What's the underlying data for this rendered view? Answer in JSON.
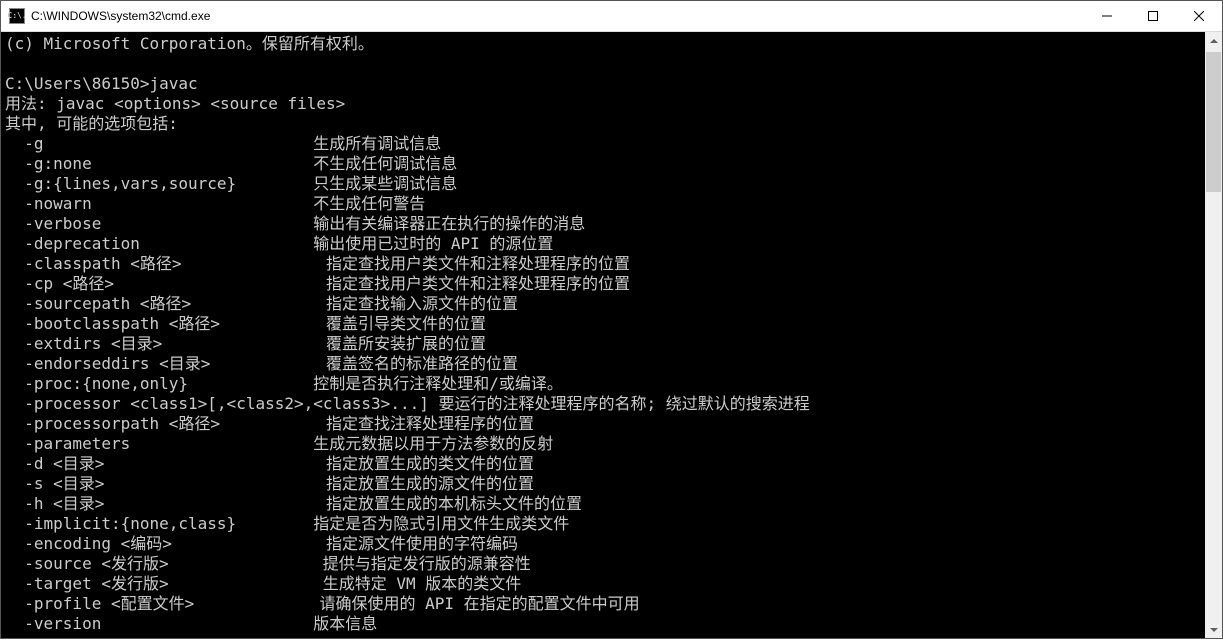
{
  "titlebar": {
    "title": "C:\\WINDOWS\\system32\\cmd.exe",
    "icon_text": "C:\\."
  },
  "terminal": {
    "line_copyright": "(c) Microsoft Corporation。保留所有权利。",
    "prompt": "C:\\Users\\86150>",
    "command": "javac",
    "usage": "用法: javac <options> <source files>",
    "options_header": "其中, 可能的选项包括:",
    "options": [
      {
        "flag": "-g",
        "desc": "生成所有调试信息"
      },
      {
        "flag": "-g:none",
        "desc": "不生成任何调试信息"
      },
      {
        "flag": "-g:{lines,vars,source}",
        "desc": "只生成某些调试信息"
      },
      {
        "flag": "-nowarn",
        "desc": "不生成任何警告"
      },
      {
        "flag": "-verbose",
        "desc": "输出有关编译器正在执行的操作的消息"
      },
      {
        "flag": "-deprecation",
        "desc": "输出使用已过时的 API 的源位置"
      },
      {
        "flag": "-classpath <路径>",
        "desc": "指定查找用户类文件和注释处理程序的位置",
        "indent": true
      },
      {
        "flag": "-cp <路径>",
        "desc": "指定查找用户类文件和注释处理程序的位置",
        "indent": true
      },
      {
        "flag": "-sourcepath <路径>",
        "desc": "指定查找输入源文件的位置",
        "indent": true
      },
      {
        "flag": "-bootclasspath <路径>",
        "desc": "覆盖引导类文件的位置",
        "indent": true
      },
      {
        "flag": "-extdirs <目录>",
        "desc": "覆盖所安装扩展的位置",
        "indent": true
      },
      {
        "flag": "-endorseddirs <目录>",
        "desc": "覆盖签名的标准路径的位置",
        "indent": true
      },
      {
        "flag": "-proc:{none,only}",
        "desc": "控制是否执行注释处理和/或编译。"
      },
      {
        "flag": "-processor <class1>[,<class2>,<class3>...]",
        "desc": "要运行的注释处理程序的名称; 绕过默认的搜索进程",
        "inline": true
      },
      {
        "flag": "-processorpath <路径>",
        "desc": "指定查找注释处理程序的位置",
        "indent": true
      },
      {
        "flag": "-parameters",
        "desc": "生成元数据以用于方法参数的反射"
      },
      {
        "flag": "-d <目录>",
        "desc": "指定放置生成的类文件的位置",
        "indent": true
      },
      {
        "flag": "-s <目录>",
        "desc": "指定放置生成的源文件的位置",
        "indent": true
      },
      {
        "flag": "-h <目录>",
        "desc": "指定放置生成的本机标头文件的位置",
        "indent": true
      },
      {
        "flag": "-implicit:{none,class}",
        "desc": "指定是否为隐式引用文件生成类文件"
      },
      {
        "flag": "-encoding <编码>",
        "desc": "指定源文件使用的字符编码",
        "indent": true
      },
      {
        "flag": "-source <发行版>",
        "desc": "提供与指定发行版的源兼容性",
        "indent": true
      },
      {
        "flag": "-target <发行版>",
        "desc": "生成特定 VM 版本的类文件",
        "indent": true
      },
      {
        "flag": "-profile <配置文件>",
        "desc": "请确保使用的 API 在指定的配置文件中可用",
        "indent": true
      },
      {
        "flag": "-version",
        "desc": "版本信息"
      }
    ]
  }
}
